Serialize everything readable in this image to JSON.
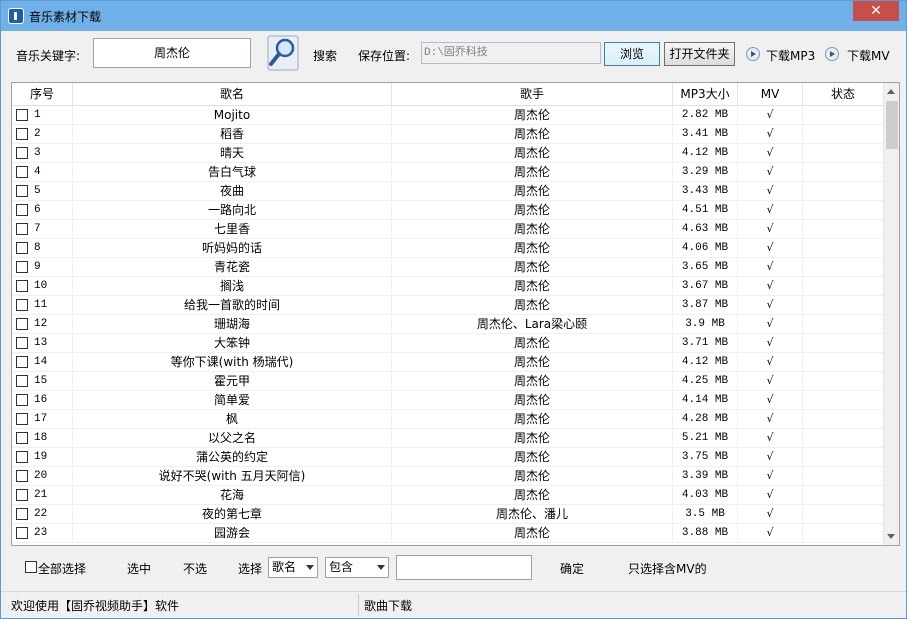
{
  "window": {
    "title": "音乐素材下载",
    "close_label": "✕"
  },
  "toolbar": {
    "keyword_label": "音乐关键字:",
    "keyword_value": "周杰伦",
    "search_label": "搜索",
    "save_label": "保存位置:",
    "save_path": "D:\\固乔科技",
    "browse_label": "浏览",
    "open_folder_label": "打开文件夹",
    "download_mp3_label": "下载MP3",
    "download_mv_label": "下载MV"
  },
  "table": {
    "columns": [
      "序号",
      "歌名",
      "歌手",
      "MP3大小",
      "MV",
      "状态"
    ],
    "rows": [
      {
        "no": "1",
        "title": "Mojito",
        "artist": "周杰伦",
        "size": "2.82 MB",
        "mv": "√",
        "status": ""
      },
      {
        "no": "2",
        "title": "稻香",
        "artist": "周杰伦",
        "size": "3.41 MB",
        "mv": "√",
        "status": ""
      },
      {
        "no": "3",
        "title": "晴天",
        "artist": "周杰伦",
        "size": "4.12 MB",
        "mv": "√",
        "status": ""
      },
      {
        "no": "4",
        "title": "告白气球",
        "artist": "周杰伦",
        "size": "3.29 MB",
        "mv": "√",
        "status": ""
      },
      {
        "no": "5",
        "title": "夜曲",
        "artist": "周杰伦",
        "size": "3.43 MB",
        "mv": "√",
        "status": ""
      },
      {
        "no": "6",
        "title": "一路向北",
        "artist": "周杰伦",
        "size": "4.51 MB",
        "mv": "√",
        "status": ""
      },
      {
        "no": "7",
        "title": "七里香",
        "artist": "周杰伦",
        "size": "4.63 MB",
        "mv": "√",
        "status": ""
      },
      {
        "no": "8",
        "title": "听妈妈的话",
        "artist": "周杰伦",
        "size": "4.06 MB",
        "mv": "√",
        "status": ""
      },
      {
        "no": "9",
        "title": "青花瓷",
        "artist": "周杰伦",
        "size": "3.65 MB",
        "mv": "√",
        "status": ""
      },
      {
        "no": "10",
        "title": "搁浅",
        "artist": "周杰伦",
        "size": "3.67 MB",
        "mv": "√",
        "status": ""
      },
      {
        "no": "11",
        "title": "给我一首歌的时间",
        "artist": "周杰伦",
        "size": "3.87 MB",
        "mv": "√",
        "status": ""
      },
      {
        "no": "12",
        "title": "珊瑚海",
        "artist": "周杰伦、Lara梁心颐",
        "size": "3.9 MB",
        "mv": "√",
        "status": ""
      },
      {
        "no": "13",
        "title": "大笨钟",
        "artist": "周杰伦",
        "size": "3.71 MB",
        "mv": "√",
        "status": ""
      },
      {
        "no": "14",
        "title": "等你下课(with 杨瑞代)",
        "artist": "周杰伦",
        "size": "4.12 MB",
        "mv": "√",
        "status": ""
      },
      {
        "no": "15",
        "title": "霍元甲",
        "artist": "周杰伦",
        "size": "4.25 MB",
        "mv": "√",
        "status": ""
      },
      {
        "no": "16",
        "title": "简单爱",
        "artist": "周杰伦",
        "size": "4.14 MB",
        "mv": "√",
        "status": ""
      },
      {
        "no": "17",
        "title": "枫",
        "artist": "周杰伦",
        "size": "4.28 MB",
        "mv": "√",
        "status": ""
      },
      {
        "no": "18",
        "title": "以父之名",
        "artist": "周杰伦",
        "size": "5.21 MB",
        "mv": "√",
        "status": ""
      },
      {
        "no": "19",
        "title": "蒲公英的约定",
        "artist": "周杰伦",
        "size": "3.75 MB",
        "mv": "√",
        "status": ""
      },
      {
        "no": "20",
        "title": "说好不哭(with 五月天阿信)",
        "artist": "周杰伦",
        "size": "3.39 MB",
        "mv": "√",
        "status": ""
      },
      {
        "no": "21",
        "title": "花海",
        "artist": "周杰伦",
        "size": "4.03 MB",
        "mv": "√",
        "status": ""
      },
      {
        "no": "22",
        "title": "夜的第七章",
        "artist": "周杰伦、潘儿",
        "size": "3.5 MB",
        "mv": "√",
        "status": ""
      },
      {
        "no": "23",
        "title": "园游会",
        "artist": "周杰伦",
        "size": "3.88 MB",
        "mv": "√",
        "status": ""
      }
    ]
  },
  "filter": {
    "select_all_label": "全部选择",
    "selected_label": "选中",
    "unselected_label": "不选",
    "choose_label": "选择",
    "field_value": "歌名",
    "mode_value": "包含",
    "confirm_label": "确定",
    "mv_only_label": "只选择含MV的"
  },
  "status": {
    "left": "欢迎使用【固乔视频助手】软件",
    "right": "歌曲下载"
  },
  "colors": {
    "titlebar": "#6fb0e8",
    "close": "#c74f4a",
    "border": "#5a9ad6"
  }
}
